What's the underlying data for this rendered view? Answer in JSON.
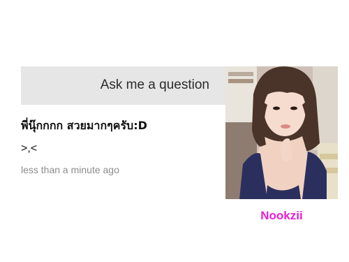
{
  "header": {
    "title": "Ask me a question"
  },
  "question": {
    "text": "พี่นุ๊กกกก  สวยมากๆครับ:D"
  },
  "answer": {
    "text": ">,<"
  },
  "meta": {
    "timestamp": "less than a minute ago"
  },
  "profile": {
    "username": "Nookzii",
    "username_color": "#e81fd6"
  },
  "colors": {
    "header_bg": "#e6e6e6",
    "timestamp": "#8c8c8c"
  }
}
